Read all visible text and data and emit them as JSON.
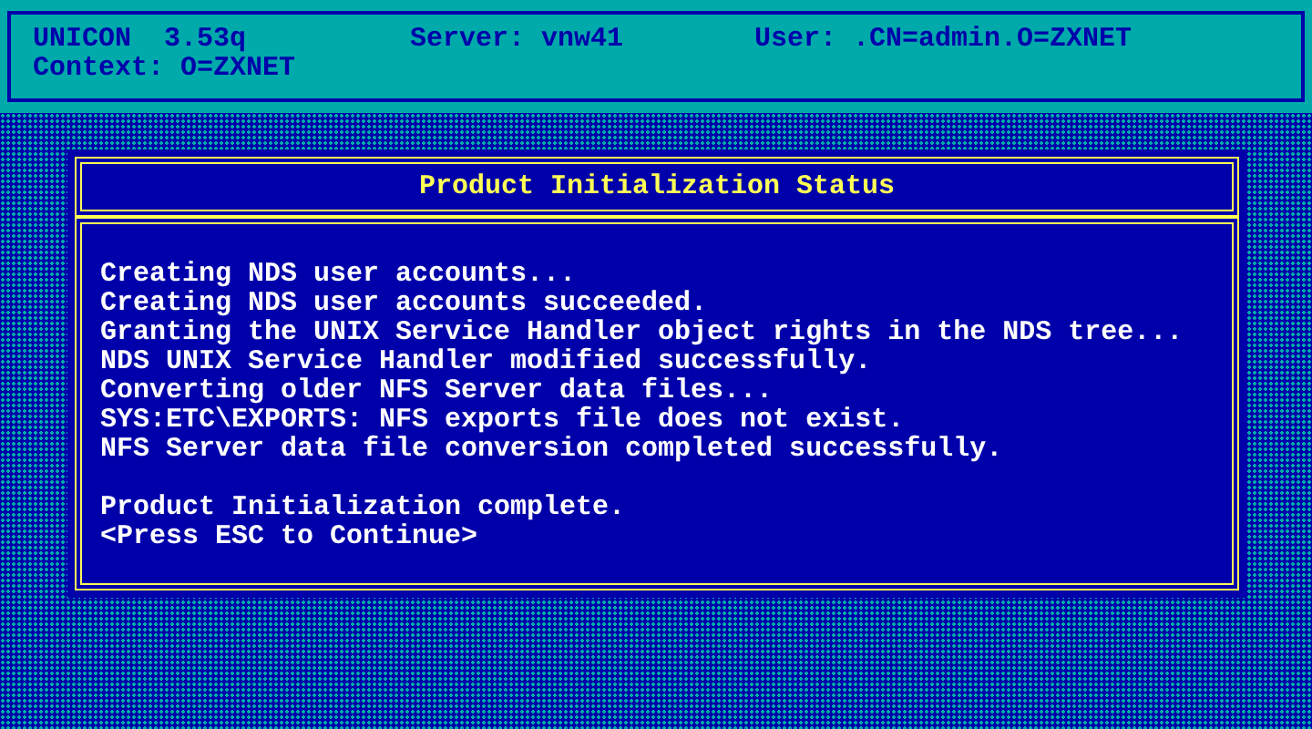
{
  "header": {
    "product": "UNICON  3.53q",
    "server": "Server: vnw41",
    "user": "User: .CN=admin.O=ZXNET",
    "context": "Context: O=ZXNET"
  },
  "dialog": {
    "title": "Product Initialization Status",
    "messages": [
      "Creating NDS user accounts...",
      "Creating NDS user accounts succeeded.",
      "Granting the UNIX Service Handler object rights in the NDS tree...",
      "NDS UNIX Service Handler modified successfully.",
      "Converting older NFS Server data files...",
      "SYS:ETC\\EXPORTS: NFS exports file does not exist.",
      "NFS Server data file conversion completed successfully."
    ],
    "footer_lines": [
      "Product Initialization complete.",
      "<Press ESC to Continue>"
    ]
  }
}
